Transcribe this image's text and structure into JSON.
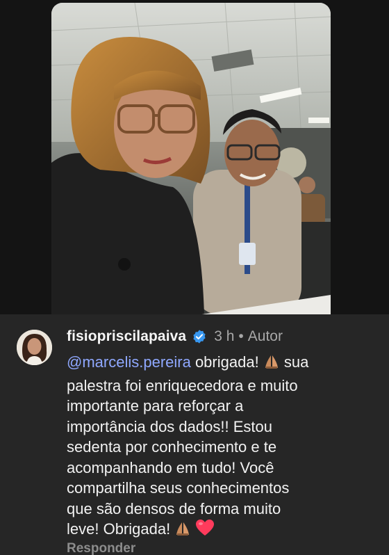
{
  "photo": {
    "icon": "photo-of-two-people-at-conference"
  },
  "comment": {
    "username": "fisiopriscilapaiva",
    "time": "3 h",
    "separator": "•",
    "author_label": "Autor",
    "mention": "@marcelis.pereira",
    "line1_after_mention": " obrigada! ",
    "line1_end": " sua",
    "line2": "palestra foi enriquecedora e muito",
    "line3": "importante para reforçar a",
    "line4": "importância dos dados!! Estou",
    "line5": "sedenta por conhecimento e te",
    "line6": "acompanhando em tudo! Você",
    "line7": "compartilha seus conhecimentos",
    "line8": "que são densos de forma muito",
    "line9_start": "leve! Obrigada! ",
    "emojis": [
      "pray-icon",
      "pray-icon",
      "heart-icon"
    ],
    "reply_label": "Responder"
  },
  "colors": {
    "panel_bg": "#262626",
    "mention": "#8fa8ff",
    "verified": "#3897f0",
    "heart": "#ff3b5c"
  }
}
